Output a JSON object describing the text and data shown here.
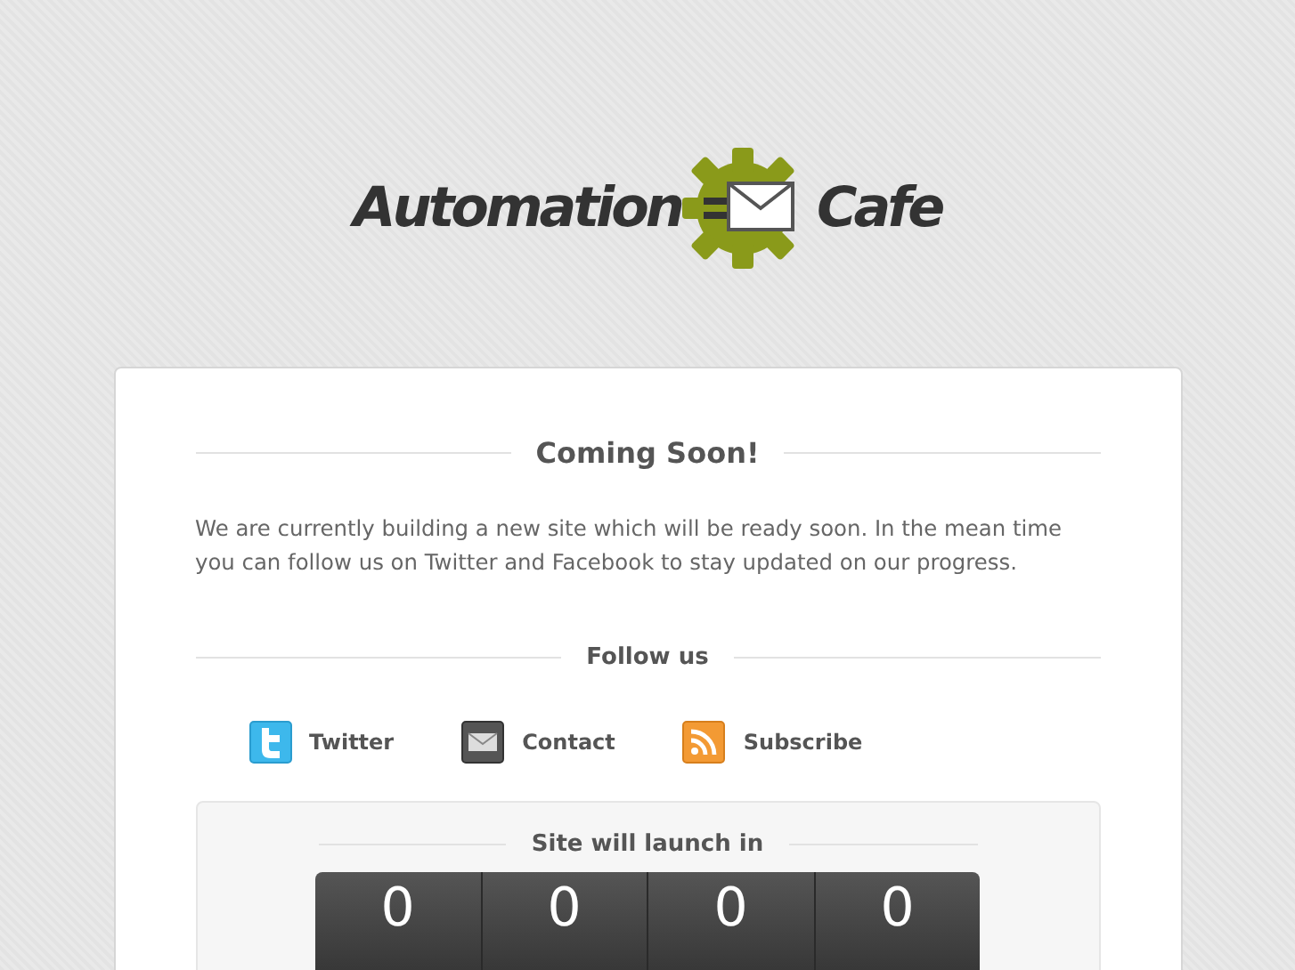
{
  "logo": {
    "word_1": "Automation",
    "word_2": "Cafe"
  },
  "heading": "Coming Soon!",
  "intro": "We are currently building a new site which will be ready soon. In the mean time you can follow us on Twitter and Facebook to stay updated on our progress.",
  "follow": {
    "title": "Follow us",
    "links": [
      {
        "label": "Twitter",
        "kind": "twitter"
      },
      {
        "label": "Contact",
        "kind": "mail"
      },
      {
        "label": "Subscribe",
        "kind": "rss"
      }
    ]
  },
  "countdown": {
    "title": "Site will launch in",
    "digits": [
      "0",
      "0",
      "0",
      "0"
    ]
  }
}
